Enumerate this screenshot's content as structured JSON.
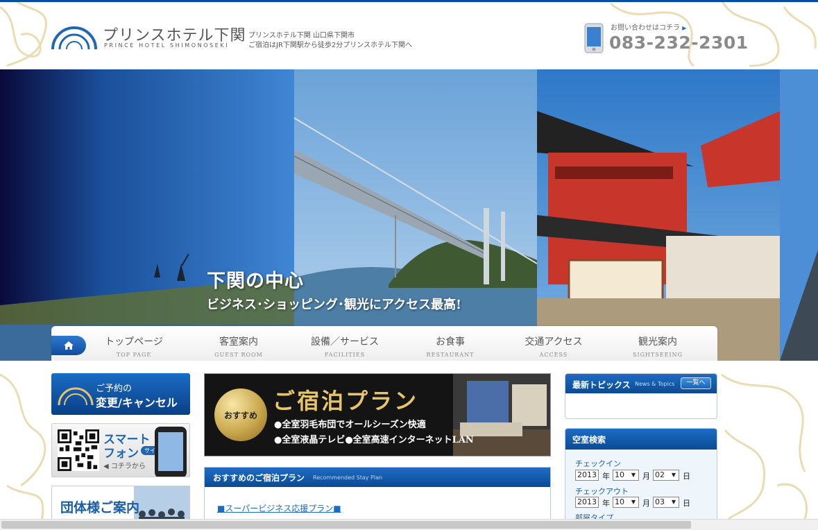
{
  "header": {
    "logo_jp": "プリンスホテル下関",
    "logo_en": "PRINCE HOTEL SHIMONOSEKI",
    "tagline_line1": "プリンスホテル下関 山口県下関市",
    "tagline_line2": "ご宿泊はJR下関駅から徒歩2分プリンスホテル下関へ",
    "contact_label": "お問い合わせはコチラ",
    "contact_arrow": "▶",
    "phone": "083-232-2301"
  },
  "hero": {
    "title": "下関の中心",
    "subtitle": "ビジネス･ショッピング･観光にアクセス最高!"
  },
  "nav": {
    "items": [
      {
        "jp": "トップページ",
        "en": "TOP PAGE"
      },
      {
        "jp": "客室案内",
        "en": "GUEST ROOM"
      },
      {
        "jp": "設備／サービス",
        "en": "FACILITIES"
      },
      {
        "jp": "お食事",
        "en": "RESTAURANT"
      },
      {
        "jp": "交通アクセス",
        "en": "ACCESS"
      },
      {
        "jp": "観光案内",
        "en": "SIGHTSEEING"
      }
    ]
  },
  "left": {
    "reserve_line1": "ご予約の",
    "reserve_line2": "変更/キャンセル",
    "smart_line1": "スマート",
    "smart_line2": "フォン",
    "smart_badge": "サイト",
    "smart_line3": "◀ コチラから",
    "group_label": "団体様ご案内"
  },
  "center": {
    "badge": "おすすめ",
    "plan_title": "ご宿泊プラン",
    "plan_line1": "●全室羽毛布団でオールシーズン快適",
    "plan_line2": "●全室液晶テレビ●全室高速インターネットLAN",
    "recommend_title_jp": "おすすめのご宿泊プラン",
    "recommend_title_en": "Recommended Stay Plan",
    "plan_link": "■スーパービジネス応援プラン■"
  },
  "right": {
    "topics_title_jp": "最新トピックス",
    "topics_title_en": "News & Topics",
    "topics_list_btn": "一覧へ",
    "vacancy_title": "空室検索",
    "checkin_label": "チェックイン",
    "checkout_label": "チェックアウト",
    "room_type_label": "部屋タイプ",
    "checkin": {
      "year": "2013",
      "month": "10",
      "day": "02"
    },
    "checkout": {
      "year": "2013",
      "month": "10",
      "day": "03"
    },
    "unit_year": "年",
    "unit_month": "月",
    "unit_day": "日"
  },
  "colors": {
    "brand_blue": "#0b4f9c",
    "gold": "#e7c568"
  }
}
